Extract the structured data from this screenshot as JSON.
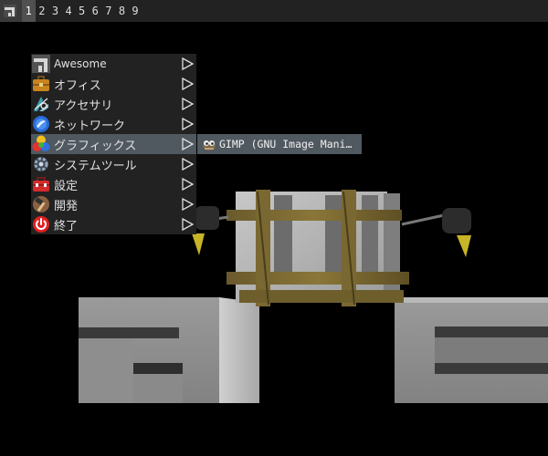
{
  "wibar": {
    "launcher_icon": "awesome-logo-icon",
    "tags": [
      "1",
      "2",
      "3",
      "4",
      "5",
      "6",
      "7",
      "8",
      "9"
    ],
    "active_tag": "1"
  },
  "menu": {
    "items": [
      {
        "label": "Awesome",
        "icon": "awesome-logo-icon"
      },
      {
        "label": "オフィス",
        "icon": "briefcase-icon"
      },
      {
        "label": "アクセサリ",
        "icon": "accessories-icon"
      },
      {
        "label": "ネットワーク",
        "icon": "network-globe-icon"
      },
      {
        "label": "グラフィックス",
        "icon": "graphics-palette-icon",
        "selected": true
      },
      {
        "label": "システムツール",
        "icon": "system-gear-icon"
      },
      {
        "label": "設定",
        "icon": "toolbox-icon"
      },
      {
        "label": "開発",
        "icon": "hammer-icon"
      },
      {
        "label": "終了",
        "icon": "power-icon"
      }
    ],
    "arrow_icon": "submenu-arrow-icon"
  },
  "submenu": {
    "items": [
      {
        "label": "GIMP (GNU Image Mani…",
        "icon": "gimp-icon"
      }
    ]
  },
  "colors": {
    "bar_bg": "#222222",
    "selected_bg": "#505860",
    "desktop_bg": "#000000"
  }
}
